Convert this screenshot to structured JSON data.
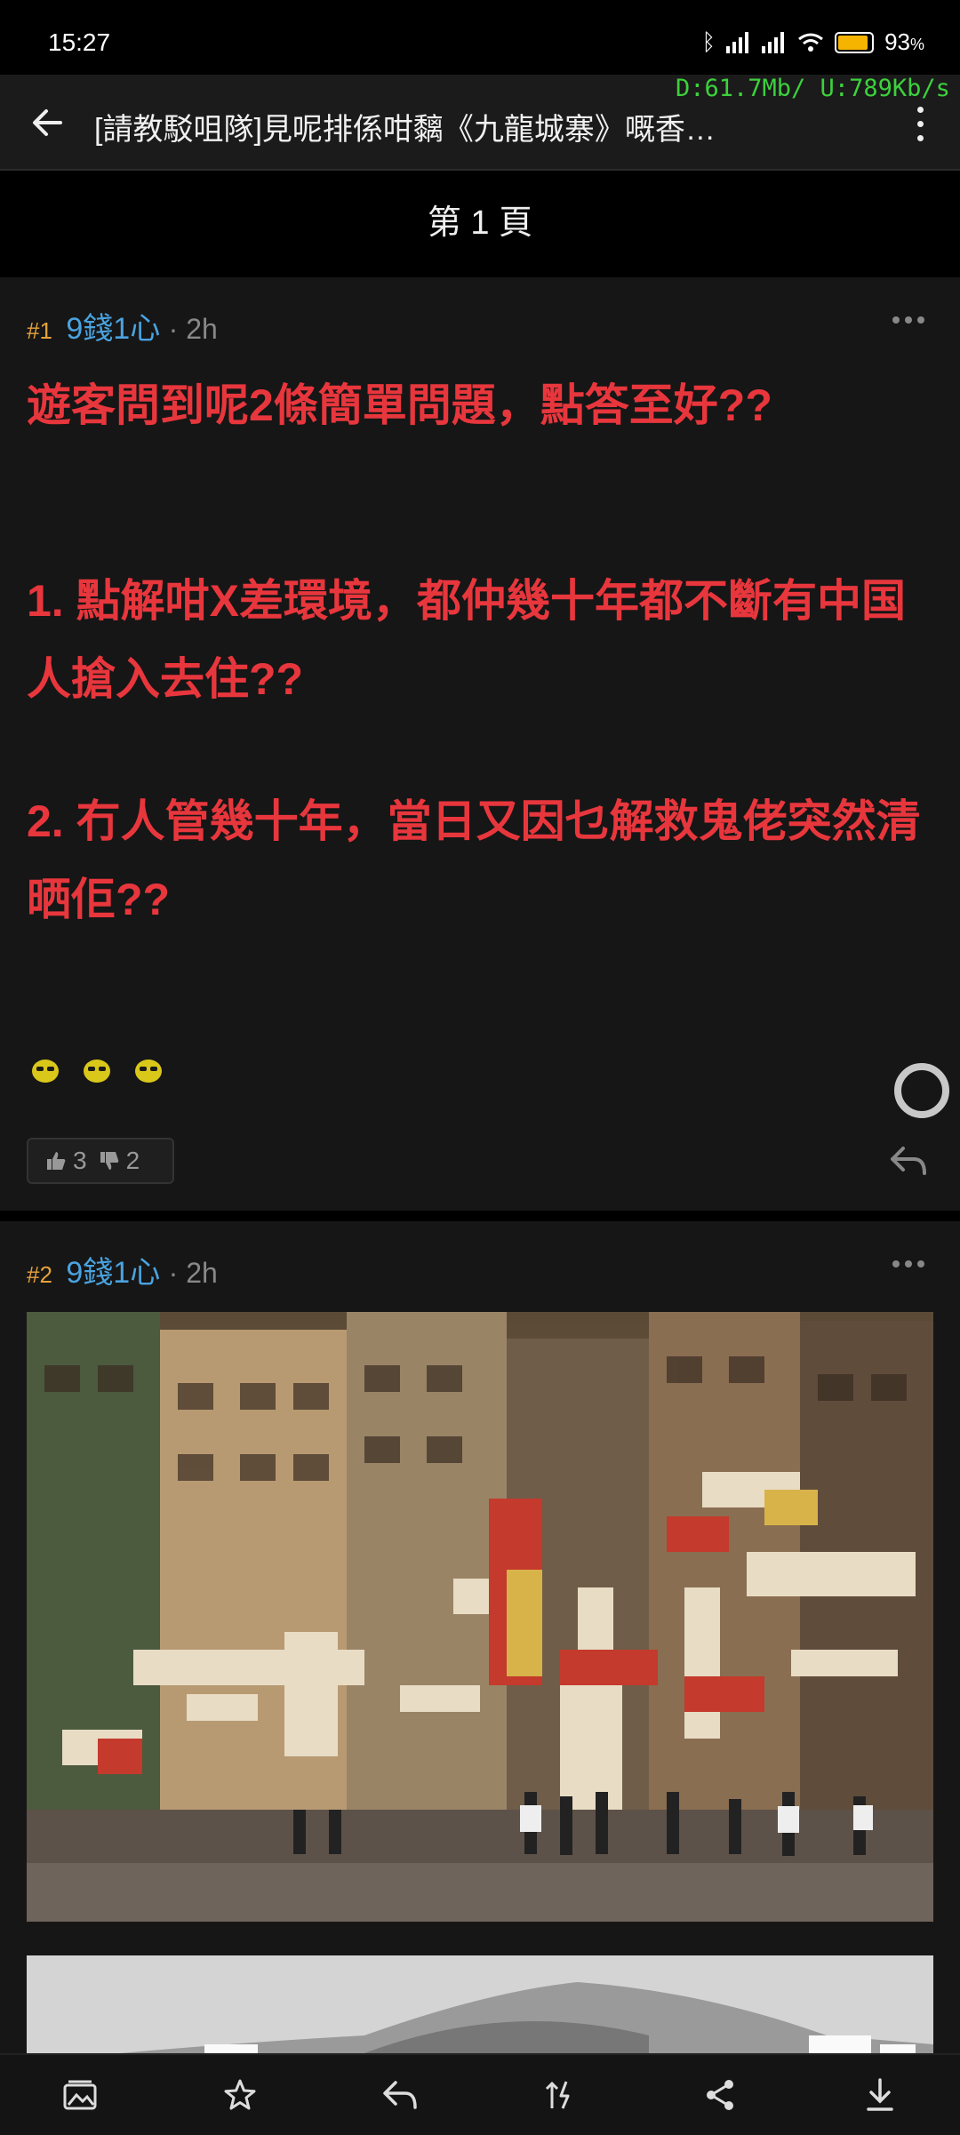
{
  "status_bar": {
    "time": "15:27",
    "battery": "93",
    "battery_unit": "%",
    "battery_level": 0.93,
    "net_speed": "D:61.7Mb/ U:789Kb/s"
  },
  "header": {
    "title": "[請教駁咀隊]見呢排係咁黐《九龍城寨》嘅香…"
  },
  "page_label": "第 1 頁",
  "posts": [
    {
      "number": "#1",
      "user": "9錢1心",
      "time": "· 2h",
      "lines": [
        "遊客問到呢2條簡單問題，點答至好??",
        "",
        "1. 點解咁X差環境，都仲幾十年都不斷有中国人搶入去住??",
        "",
        "2. 冇人管幾十年，當日又因乜解救鬼佬突然清晒佢??"
      ],
      "likes": "3",
      "dislikes": "2"
    },
    {
      "number": "#2",
      "user": "9錢1心",
      "time": "· 2h"
    }
  ],
  "colors": {
    "post_text": "#e8363d",
    "username": "#4aa3e0",
    "post_number": "#e6a23c",
    "net_speed": "#3cd13c"
  },
  "icons": {
    "back": "arrow-left-icon",
    "menu": "more-vertical-icon",
    "bottom_bar": [
      "image-icon",
      "star-icon",
      "reply-icon",
      "sort-icon",
      "share-icon",
      "download-icon"
    ]
  }
}
